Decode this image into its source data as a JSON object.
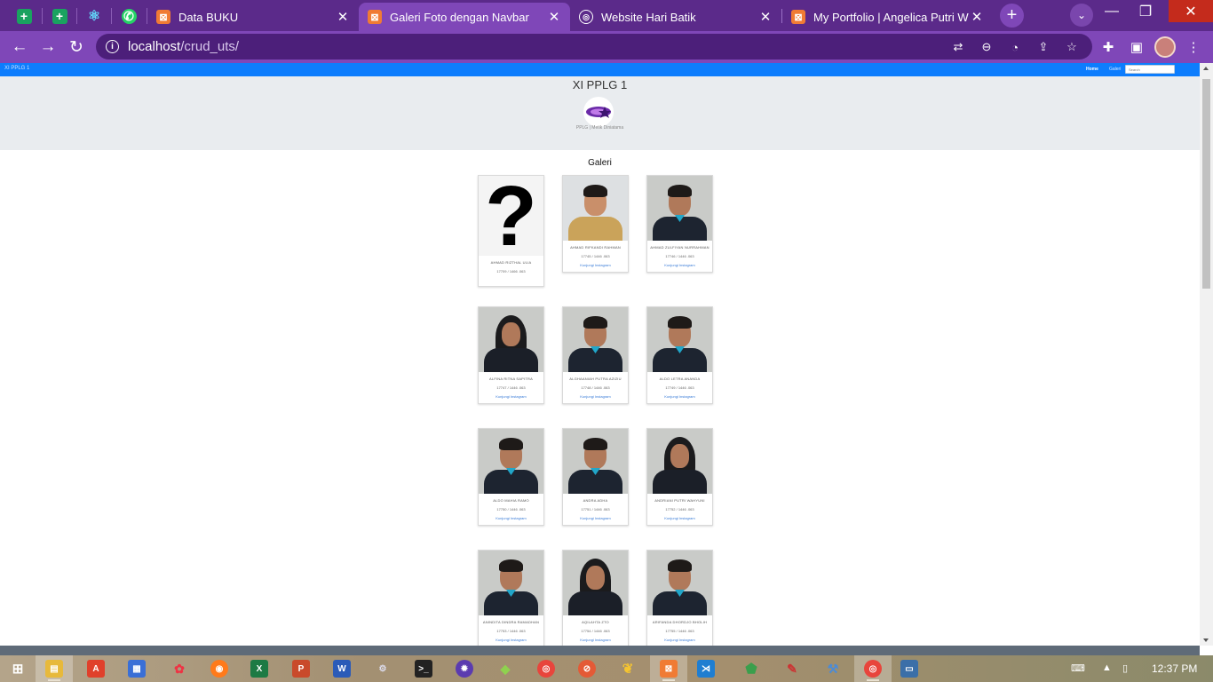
{
  "browser": {
    "tabs": [
      {
        "title": "Data BUKU",
        "active": false
      },
      {
        "title": "Galeri Foto dengan Navbar",
        "active": true
      },
      {
        "title": "Website Hari Batik",
        "active": false
      },
      {
        "title": "My Portfolio | Angelica Putri W",
        "active": false
      }
    ],
    "url_host": "localhost",
    "url_path": "/crud_uts/"
  },
  "site": {
    "brand": "XI PPLG 1",
    "nav": {
      "home": "Home",
      "galeri": "Galeri",
      "search_placeholder": "Search"
    },
    "header_title": "XI PPLG 1",
    "header_subtitle": "PPLG | Metik Diniatama",
    "gallery_title": "Galeri",
    "link_label": "Kunjungi Instagram"
  },
  "students": [
    {
      "name": "AHMAD RIZTHAL ULIA",
      "nis": "17709 / 1466 .063",
      "photo": "question"
    },
    {
      "name": "AHMAD RIFKANDI RAHMAN",
      "nis": "17745 / 1446 .063",
      "photo": "boy-glasses"
    },
    {
      "name": "AHMAD ZULFIYAN NURRAHMAN",
      "nis": "17746 / 1446 .063",
      "photo": "boy"
    },
    {
      "name": "ALFINA RITNA SAPITRA",
      "nis": "17747 / 1446 .063",
      "photo": "girl"
    },
    {
      "name": "ALGHAANIAH PUTRA AZIZIU",
      "nis": "17748 / 1446 .063",
      "photo": "boy"
    },
    {
      "name": "ALDO LETRA ANANDA",
      "nis": "17749 / 1446 .063",
      "photo": "boy"
    },
    {
      "name": "ALDO MAHIA RAMO",
      "nis": "17750 / 1446 .063",
      "photo": "boy"
    },
    {
      "name": "ANDRA ADHA",
      "nis": "17751 / 1446 .063",
      "photo": "boy"
    },
    {
      "name": "ANDRIANI PUTRI WAHYUNI",
      "nis": "17752 / 1446 .063",
      "photo": "girl"
    },
    {
      "name": "ANINDITA DINDRA RAMADHAN",
      "nis": "17753 / 1446 .063",
      "photo": "boy"
    },
    {
      "name": "AQILAHTA ZTO",
      "nis": "17754 / 1446 .063",
      "photo": "girl"
    },
    {
      "name": "ARIFANDA DHORDJO BHOLIH",
      "nis": "17755 / 1446 .063",
      "photo": "boy"
    }
  ],
  "taskbar": {
    "time": "12:37 PM"
  },
  "colors": {
    "tabstrip": "#5b2a8a",
    "toolbar": "#7f47b8",
    "navbar": "#0d7dfd",
    "jumbotron": "#e9ecef"
  }
}
